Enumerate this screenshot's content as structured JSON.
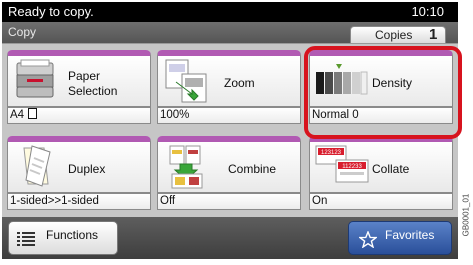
{
  "status": {
    "message": "Ready to copy.",
    "time": "10:10"
  },
  "screen": {
    "title": "Copy",
    "copies_label": "Copies",
    "copies_value": "1"
  },
  "tiles": {
    "paper_selection": {
      "label_line1": "Paper",
      "label_line2": "Selection",
      "value": "A4",
      "icon": "paper-tray-icon"
    },
    "zoom": {
      "label": "Zoom",
      "value": "100%",
      "icon": "zoom-icon"
    },
    "density": {
      "label": "Density",
      "value": "Normal 0",
      "icon": "density-icon"
    },
    "duplex": {
      "label": "Duplex",
      "value": "1-sided>>1-sided",
      "icon": "duplex-icon"
    },
    "combine": {
      "label": "Combine",
      "value": "Off",
      "icon": "combine-icon"
    },
    "collate": {
      "label": "Collate",
      "value": "On",
      "icon": "collate-icon",
      "icon_text_1": "123123",
      "icon_text_2": "112233"
    }
  },
  "bottom": {
    "functions_label": "Functions",
    "favorites_label": "Favorites"
  },
  "side_code": "GB0001_01",
  "colors": {
    "tile_accent": "#b15ab3",
    "highlight": "#d7131e",
    "favorites": "#3a62b0"
  }
}
